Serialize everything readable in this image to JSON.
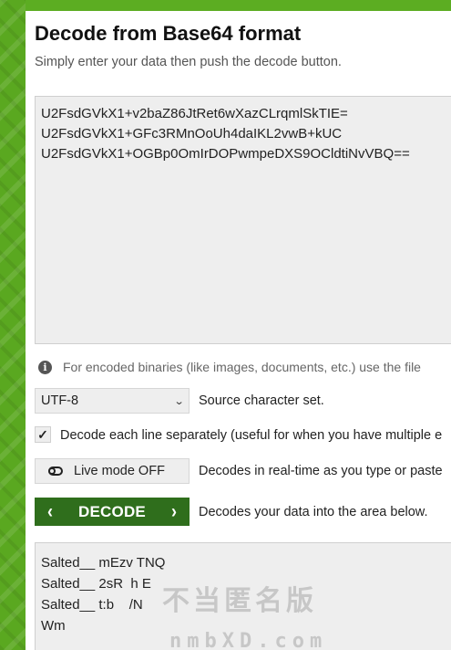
{
  "header": {
    "title": "Decode from Base64 format",
    "subtitle": "Simply enter your data then push the decode button."
  },
  "input": {
    "value": "U2FsdGVkX1+v2baZ86JtRet6wXazCLrqmlSkTIE=\nU2FsdGVkX1+GFc3RMnOoUh4daIKL2vwB+kUC\nU2FsdGVkX1+OGBp0OmIrDOPwmpeDXS9OCldtiNvVBQ=="
  },
  "info": {
    "text": "For encoded binaries (like images, documents, etc.) use the file"
  },
  "charset": {
    "selected": "UTF-8",
    "label": "Source character set."
  },
  "line_option": {
    "checked": true,
    "label": "Decode each line separately (useful for when you have multiple e"
  },
  "live_mode": {
    "button_label": "Live mode OFF",
    "description": "Decodes in real-time as you type or paste"
  },
  "decode": {
    "button_label": "DECODE",
    "left_arrow": "‹",
    "right_arrow": "›",
    "description": "Decodes your data into the area below."
  },
  "output": {
    "value": "Salted__ mEzv TNQ\nSalted__ 2sR  h E\nSalted__ t:b    /N\nWm"
  },
  "watermark": {
    "main": "不当匿名版",
    "sub": "nmbXD.com"
  },
  "colors": {
    "accent_green": "#5cad22",
    "decode_button": "#2f6e1c"
  },
  "icons": {
    "info": "info-circle-icon",
    "chevron": "chevron-down-icon",
    "toggle": "toggle-off-icon",
    "checkmark": "checkmark-icon",
    "arrow_left": "chevron-left-icon",
    "arrow_right": "chevron-right-icon"
  }
}
